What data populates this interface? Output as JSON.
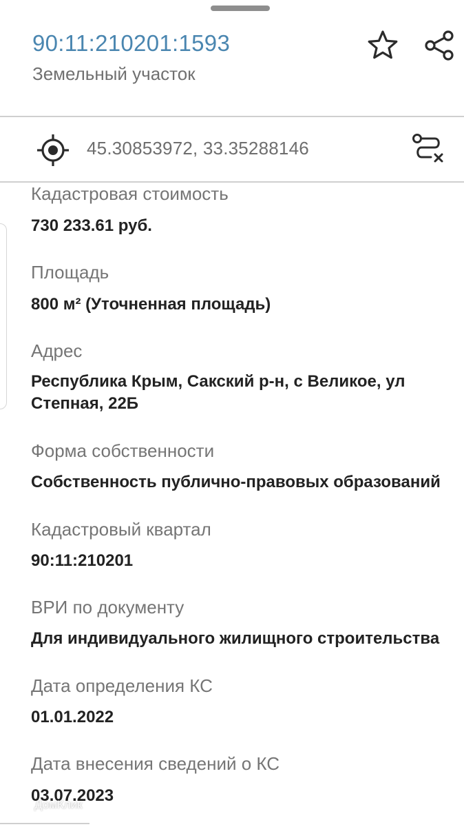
{
  "header": {
    "cadastral_number": "90:11:210201:1593",
    "object_type": "Земельный участок"
  },
  "location": {
    "coordinates": "45.30853972, 33.35288146"
  },
  "fields": [
    {
      "label": "Кадастровая стоимость",
      "value": "730 233.61 руб."
    },
    {
      "label": "Площадь",
      "value": "800 м² (Уточненная площадь)"
    },
    {
      "label": "Адрес",
      "value": "Республика Крым, Сакский р-н, с Великое, ул Степная, 22Б"
    },
    {
      "label": "Форма собственности",
      "value": "Собственность публично-правовых образований"
    },
    {
      "label": "Кадастровый квартал",
      "value": "90:11:210201"
    },
    {
      "label": "ВРИ по документу",
      "value": "Для индивидуального жилищного строительства"
    },
    {
      "label": "Дата определения КС",
      "value": "01.01.2022"
    },
    {
      "label": "Дата внесения сведений о КС",
      "value": "03.07.2023"
    }
  ],
  "watermark": {
    "text": "ДомКлик"
  },
  "icons": {
    "favorite": "star-icon",
    "share": "share-icon",
    "location": "crosshair-icon",
    "route": "route-clear-icon"
  },
  "colors": {
    "cadastral_number": "#4a86b0",
    "label": "#757575",
    "value": "#222222",
    "divider": "#cfcfcf"
  }
}
